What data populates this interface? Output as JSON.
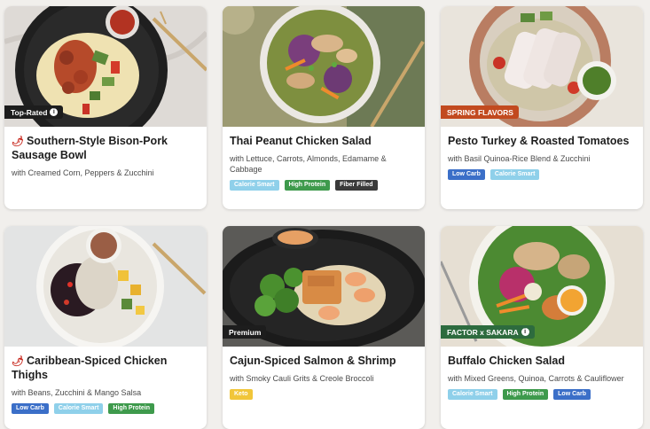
{
  "colors": {
    "low_carb": "#3b6fc8",
    "calorie_smart": "#8fd0ea",
    "high_protein": "#3e9a4c",
    "fiber_filled": "#3a3a3a",
    "keto": "#f1c63a",
    "badge_dark": "#1d1d1d",
    "badge_spring": "#c24a1f",
    "badge_sakara": "#2d6b3e",
    "pepper": "#c8281e"
  },
  "meals": [
    {
      "badge": "Top-Rated",
      "badge_info": true,
      "spicy": true,
      "title": "Southern-Style Bison-Pork Sausage Bowl",
      "subtitle": "with Creamed Corn, Peppers & Zucchini",
      "tags": []
    },
    {
      "badge": "",
      "badge_info": false,
      "spicy": false,
      "title": "Thai Peanut Chicken Salad",
      "subtitle": "with Lettuce, Carrots, Almonds, Edamame & Cabbage",
      "tags": [
        "Calorie Smart",
        "High Protein",
        "Fiber Filled"
      ]
    },
    {
      "badge": "SPRING FLAVORS",
      "badge_info": false,
      "spicy": false,
      "title": "Pesto Turkey & Roasted Tomatoes",
      "subtitle": "with Basil Quinoa-Rice Blend & Zucchini",
      "tags": [
        "Low Carb",
        "Calorie Smart"
      ]
    },
    {
      "badge": "",
      "badge_info": false,
      "spicy": true,
      "title": "Caribbean-Spiced Chicken Thighs",
      "subtitle": "with Beans, Zucchini & Mango Salsa",
      "tags": [
        "Low Carb",
        "Calorie Smart",
        "High Protein"
      ]
    },
    {
      "badge": "Premium",
      "badge_info": false,
      "spicy": false,
      "title": "Cajun-Spiced Salmon & Shrimp",
      "subtitle": "with Smoky Cauli Grits & Creole Broccoli",
      "tags": [
        "Keto"
      ]
    },
    {
      "badge": "FACTOR x SAKARA",
      "badge_info": true,
      "spicy": false,
      "title": "Buffalo Chicken Salad",
      "subtitle": "with Mixed Greens, Quinoa, Carrots & Cauliflower",
      "tags": [
        "Calorie Smart",
        "High Protein",
        "Low Carb"
      ]
    }
  ]
}
